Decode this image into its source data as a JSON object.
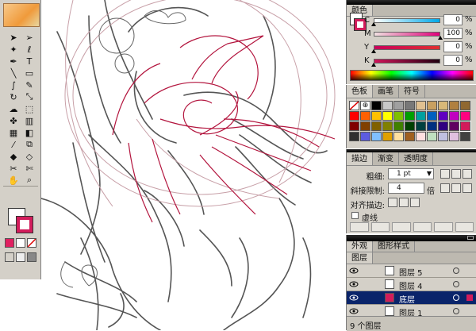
{
  "tools": {
    "icons": [
      "selection-tool",
      "direct-selection-tool",
      "magic-wand-tool",
      "lasso-tool",
      "pen-tool",
      "type-tool",
      "line-tool",
      "rectangle-tool",
      "paintbrush-tool",
      "pencil-tool",
      "rotate-tool",
      "scale-tool",
      "warp-tool",
      "free-transform-tool",
      "symbol-sprayer-tool",
      "column-graph-tool",
      "mesh-tool",
      "gradient-tool",
      "eyedropper-tool",
      "blend-tool",
      "live-paint-bucket-tool",
      "live-paint-selection-tool",
      "slice-tool",
      "scissors-tool",
      "hand-tool",
      "zoom-tool"
    ],
    "fill_color": "#ffffff",
    "stroke_color": "#d21c5b"
  },
  "color_panel": {
    "tab": "颜色",
    "channels": [
      {
        "label": "C",
        "value": "0",
        "unit": "%",
        "level": 0,
        "gradient": [
          "#ffffff",
          "#00a8e8"
        ]
      },
      {
        "label": "M",
        "value": "100",
        "unit": "%",
        "level": 1,
        "gradient": [
          "#f0e0e0",
          "#e0007a"
        ]
      },
      {
        "label": "Y",
        "value": "0",
        "unit": "%",
        "level": 0,
        "gradient": [
          "#c8005a",
          "#e03030"
        ]
      },
      {
        "label": "K",
        "value": "0",
        "unit": "%",
        "level": 0,
        "gradient": [
          "#d0145a",
          "#200010"
        ]
      }
    ]
  },
  "swatch_panel": {
    "tabs": [
      "色板",
      "画笔",
      "符号"
    ],
    "colors": [
      "#ffffff",
      "#ffffff",
      "#000000",
      "#c8c8c8",
      "#a0a0a0",
      "#787878",
      "#e0c090",
      "#c8a060",
      "#d8b878",
      "#b08040",
      "#906830",
      "#ff0000",
      "#ff6000",
      "#ffc000",
      "#ffff00",
      "#80c000",
      "#00a000",
      "#00a0a0",
      "#0060c0",
      "#6000c0",
      "#c000c0",
      "#ff0080",
      "#800000",
      "#804000",
      "#806000",
      "#808000",
      "#408000",
      "#004000",
      "#004040",
      "#003080",
      "#300080",
      "#600060",
      "#d21c5b",
      "#303030",
      "#5c5ce0",
      "#80c0ff",
      "#e0a000",
      "#ffe0a0",
      "#a06020",
      "#ffe0e0",
      "#c0e0c0",
      "#c0c0e0",
      "#e0c0e0",
      "#404040"
    ]
  },
  "stroke_panel": {
    "tabs": [
      "描边",
      "渐变",
      "透明度"
    ],
    "weight_label": "粗细:",
    "weight_value": "1 pt",
    "miter_label": "斜接限制:",
    "miter_value": "4",
    "miter_unit": "倍",
    "align_label": "对齐描边:",
    "dashed_label": "虚线"
  },
  "layers_panel": {
    "tabs": [
      "外观",
      "图形样式"
    ],
    "tab_layers": "图层",
    "layers": [
      {
        "name": "图层 5",
        "selected": false
      },
      {
        "name": "图层 4",
        "selected": false
      },
      {
        "name": "底层",
        "selected": true
      },
      {
        "name": "图层 1",
        "selected": false
      }
    ],
    "footer": "9 个图层"
  }
}
